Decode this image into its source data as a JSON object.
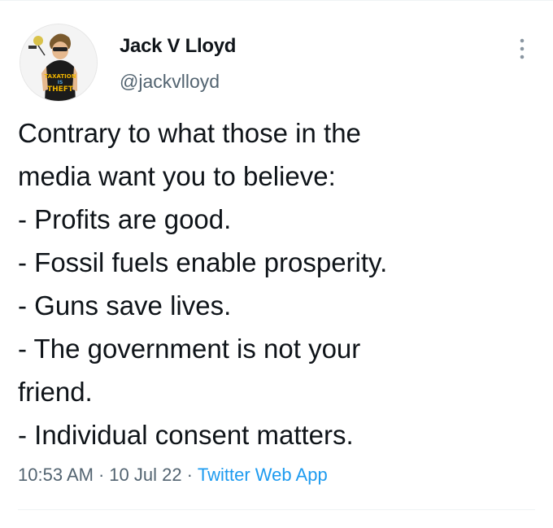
{
  "author": {
    "display_name": "Jack V Lloyd",
    "handle": "@jackvlloyd",
    "avatar_shirt_text": "TAXATION IS THEFT"
  },
  "tweet": {
    "lines": [
      "Contrary to what those in the",
      "media want you to believe:",
      "- Profits are good.",
      "- Fossil fuels enable prosperity.",
      "- Guns save lives.",
      "- The government is not your",
      "friend.",
      "- Individual consent matters."
    ]
  },
  "meta": {
    "time": "10:53 AM",
    "separator": "·",
    "date": "10 Jul 22",
    "source": "Twitter Web App"
  },
  "icons": {
    "more": "more-vertical-icon"
  },
  "colors": {
    "text_primary": "#0f1419",
    "text_secondary": "#536471",
    "link": "#1d9bf0",
    "divider": "#eff3f4"
  }
}
